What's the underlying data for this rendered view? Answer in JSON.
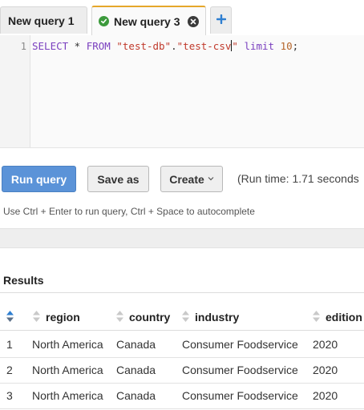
{
  "tabs": [
    {
      "label": "New query 1"
    },
    {
      "label": "New query 3"
    }
  ],
  "editor": {
    "line_number": "1",
    "code": {
      "t1": "SELECT",
      "t2": " * ",
      "t3": "FROM",
      "t4": " ",
      "t5": "\"test-db\"",
      "t6": ".",
      "t7": "\"test-csv",
      "t8": "\"",
      "t9": " ",
      "t10": "limit",
      "t11": " ",
      "t12": "10",
      "t13": ";"
    }
  },
  "toolbar": {
    "run_label": "Run query",
    "save_label": "Save as",
    "create_label": "Create",
    "runtime_text": "(Run time: 1.71 seconds"
  },
  "hint": "Use Ctrl + Enter to run query, Ctrl + Space to autocomplete",
  "results": {
    "title": "Results",
    "columns": [
      "region",
      "country",
      "industry",
      "edition"
    ],
    "rows": [
      {
        "n": "1",
        "region": "North America",
        "country": "Canada",
        "industry": "Consumer Foodservice",
        "edition": "2020"
      },
      {
        "n": "2",
        "region": "North America",
        "country": "Canada",
        "industry": "Consumer Foodservice",
        "edition": "2020"
      },
      {
        "n": "3",
        "region": "North America",
        "country": "Canada",
        "industry": "Consumer Foodservice",
        "edition": "2020"
      }
    ]
  },
  "colors": {
    "active_tab_accent": "#e5a72a",
    "primary_button": "#5b93d8",
    "success_check": "#3c9a3c",
    "add_tab_plus": "#2f7fd1"
  },
  "icons": [
    "check-icon",
    "close-icon",
    "plus-icon",
    "chevron-down-icon",
    "sort-icon"
  ]
}
